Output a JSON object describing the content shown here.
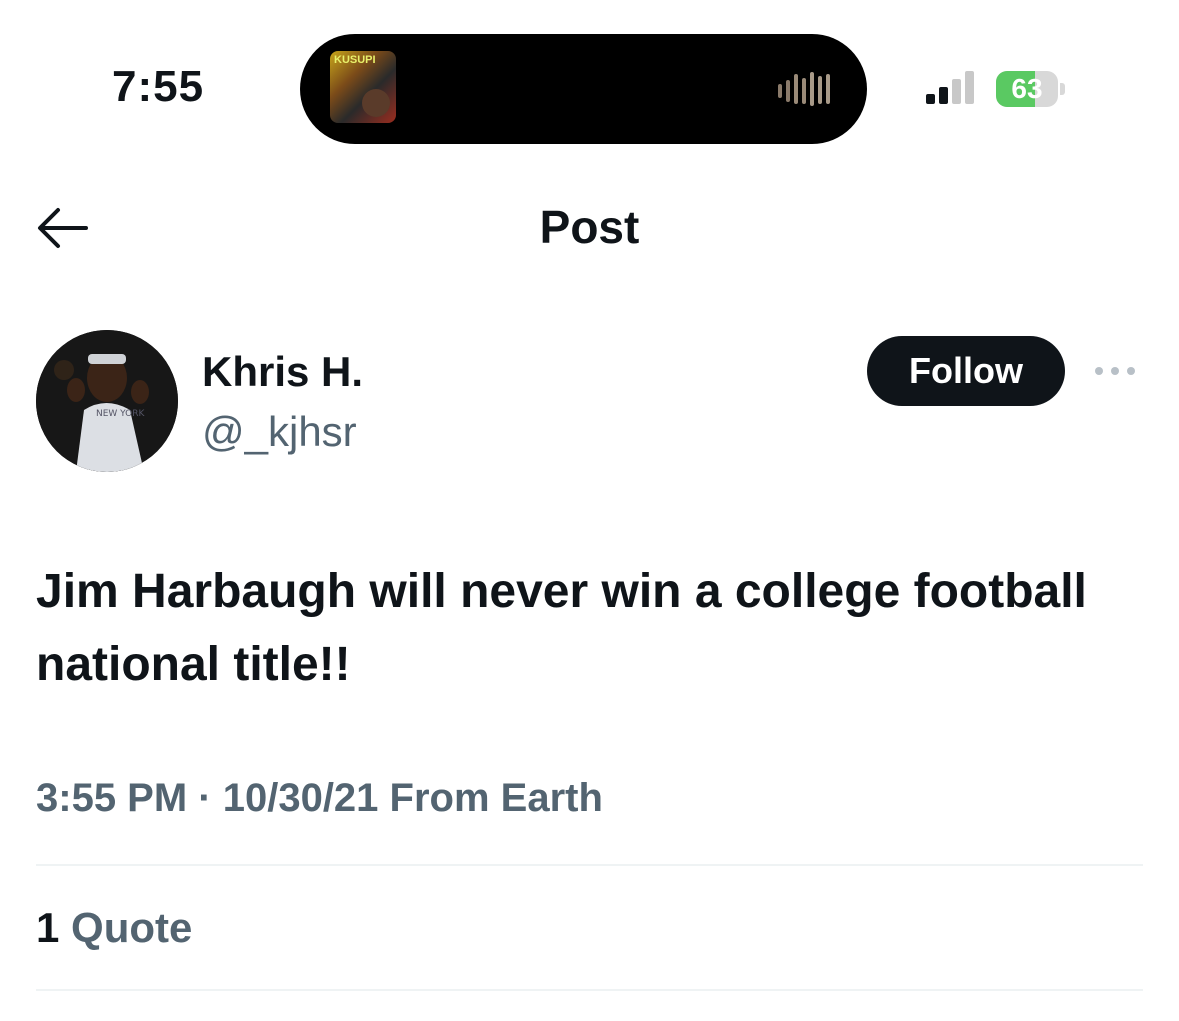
{
  "status_bar": {
    "time": "7:55",
    "battery_percent": "63",
    "battery_level": 0.63,
    "signal_bars_active": 2,
    "signal_bars_total": 4,
    "now_playing_art_label": "KUSUPI"
  },
  "header": {
    "title": "Post",
    "back_icon": "arrow-left-icon"
  },
  "author": {
    "display_name": "Khris H.",
    "handle": "@_kjhsr",
    "follow_label": "Follow",
    "more_icon": "more-horizontal-icon"
  },
  "post": {
    "text": "Jim Harbaugh will never win a college football national title!!",
    "meta": "3:55 PM · 10/30/21 From Earth"
  },
  "stats": {
    "quote_count": "1",
    "quote_label": "Quote"
  },
  "colors": {
    "text_primary": "#0f1419",
    "text_secondary": "#536471",
    "divider": "#eff3f4",
    "battery_green": "#5ac962"
  }
}
